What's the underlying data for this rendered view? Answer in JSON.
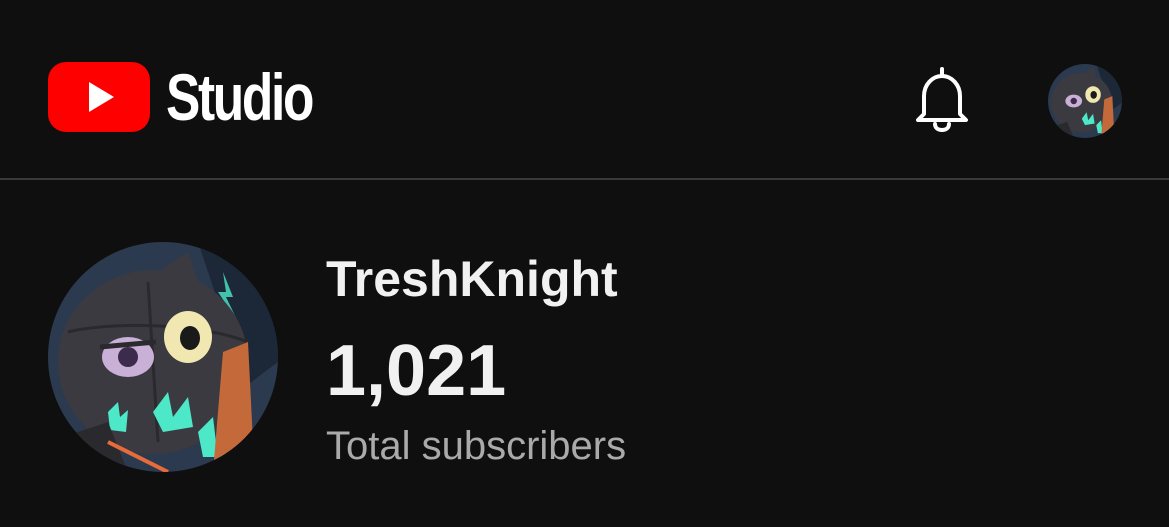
{
  "header": {
    "logo_text": "Studio",
    "brand_color": "#ff0000",
    "icons": [
      "youtube-play-icon",
      "bell-icon"
    ]
  },
  "channel": {
    "name": "TreshKnight",
    "subscriber_count": "1,021",
    "subscriber_label": "Total subscribers"
  },
  "colors": {
    "background": "#0f0f0f",
    "primary_text": "#f1f1f1",
    "secondary_text": "#aaaaaa",
    "divider": "#3a3a3a",
    "avatar_accent": "#4de8c8"
  }
}
